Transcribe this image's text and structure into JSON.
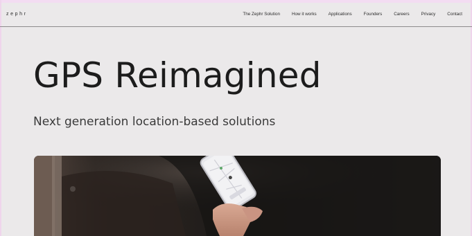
{
  "nav": {
    "logo": "zephr",
    "links": [
      "The Zephr Solution",
      "How it works",
      "Applications",
      "Founders",
      "Careers",
      "Privacy",
      "Contact"
    ]
  },
  "hero": {
    "title": "GPS Reimagined",
    "subtitle": "Next generation location-based solutions",
    "image_description_icon": "phone-map-photo"
  },
  "colors": {
    "background": "#ebe9ea",
    "text": "#1c1c1c",
    "accent_strip": "#f3dcf2"
  }
}
